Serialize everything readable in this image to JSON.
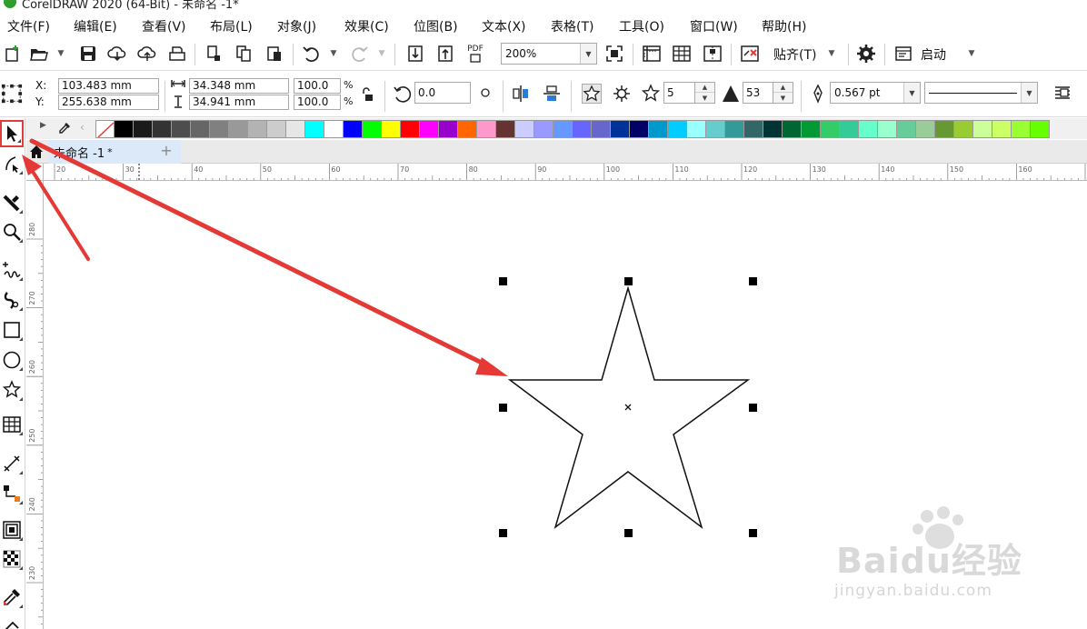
{
  "app": {
    "title": "CorelDRAW 2020 (64-Bit) - 未命名 -1*"
  },
  "menu": [
    {
      "label": "文件(F)",
      "name": "menu-file"
    },
    {
      "label": "编辑(E)",
      "name": "menu-edit"
    },
    {
      "label": "查看(V)",
      "name": "menu-view"
    },
    {
      "label": "布局(L)",
      "name": "menu-layout"
    },
    {
      "label": "对象(J)",
      "name": "menu-object"
    },
    {
      "label": "效果(C)",
      "name": "menu-effects"
    },
    {
      "label": "位图(B)",
      "name": "menu-bitmaps"
    },
    {
      "label": "文本(X)",
      "name": "menu-text"
    },
    {
      "label": "表格(T)",
      "name": "menu-table"
    },
    {
      "label": "工具(O)",
      "name": "menu-tools"
    },
    {
      "label": "窗口(W)",
      "name": "menu-window"
    },
    {
      "label": "帮助(H)",
      "name": "menu-help"
    }
  ],
  "toolbar": {
    "zoom": "200%",
    "pdf_label": "PDF",
    "snap_label": "贴齐(T)",
    "launch_label": "启动"
  },
  "propbar": {
    "x_label": "X:",
    "y_label": "Y:",
    "x_value": "103.483 mm",
    "y_value": "255.638 mm",
    "width_value": "34.348 mm",
    "height_value": "34.941 mm",
    "scale_w": "100.0",
    "scale_h": "100.0",
    "percent": "%",
    "rotation": "0.0",
    "points": "5",
    "sharpness": "53",
    "outline_width": "0.567 pt"
  },
  "palette": {
    "colors": [
      "#000000",
      "#1a1a1a",
      "#333333",
      "#4d4d4d",
      "#666666",
      "#808080",
      "#999999",
      "#b3b3b3",
      "#cccccc",
      "#e6e6e6",
      "#00ffff",
      "#ffffff",
      "#0000ff",
      "#00ff00",
      "#ffff00",
      "#ff0000",
      "#ff00ff",
      "#9900cc",
      "#ff6600",
      "#ff99cc",
      "#663333",
      "#ccccff",
      "#9999ff",
      "#6699ff",
      "#6666ff",
      "#6666cc",
      "#003399",
      "#000066",
      "#0099cc",
      "#00ccff",
      "#99ffff",
      "#66cccc",
      "#339999",
      "#336666",
      "#003333",
      "#006633",
      "#009933",
      "#33cc66",
      "#33cc99",
      "#66ffcc",
      "#99ffcc",
      "#66cc99",
      "#99cc99",
      "#669933",
      "#99cc33",
      "#ccff99",
      "#ccff66",
      "#99ff33",
      "#66ff00"
    ]
  },
  "document": {
    "tab_name": "未命名 -1",
    "tab_modified": "*"
  },
  "ruler": {
    "h_ticks": [
      "20",
      "30",
      "40",
      "50",
      "60",
      "70",
      "80",
      "90",
      "100",
      "110",
      "120",
      "130",
      "140",
      "150",
      "160",
      "17"
    ],
    "v_ticks": [
      "280",
      "270",
      "260",
      "250",
      "240",
      "230"
    ]
  },
  "watermark": {
    "brand": "Baidu经验",
    "url": "jingyan.baidu.com"
  },
  "colors": {
    "accent_red": "#e53935",
    "tab_blue": "#dbe9f8",
    "app_green": "#2d9f2d"
  }
}
